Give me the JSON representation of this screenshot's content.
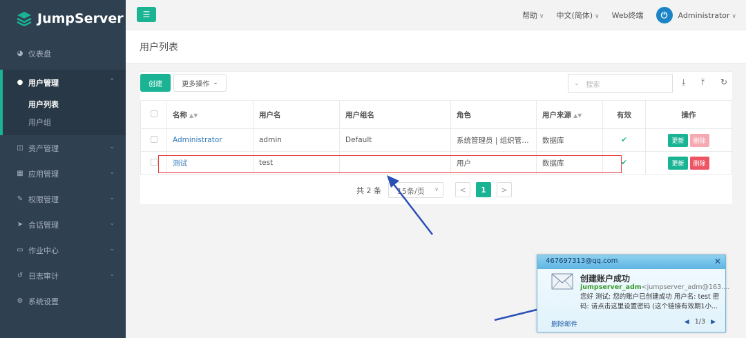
{
  "app": {
    "logo_text": "JumpServer"
  },
  "sidebar": {
    "dashboard": "仪表盘",
    "user_mgmt": "用户管理",
    "user_list": "用户列表",
    "user_group": "用户组",
    "items": [
      "资产管理",
      "应用管理",
      "权限管理",
      "会话管理",
      "作业中心",
      "日志审计",
      "系统设置"
    ]
  },
  "topbar": {
    "help": "帮助",
    "lang": "中文(简体)",
    "webterm": "Web终端",
    "user": "Administrator"
  },
  "page": {
    "title": "用户列表"
  },
  "toolbar": {
    "create": "创建",
    "more": "更多操作",
    "search_placeholder": "搜索"
  },
  "table": {
    "headers": [
      "名称",
      "用户名",
      "用户组名",
      "角色",
      "用户来源",
      "有效",
      "操作"
    ],
    "update_label": "更新",
    "delete_label": "删除",
    "rows": [
      {
        "name": "Administrator",
        "username": "admin",
        "group": "Default",
        "role": "系统管理员 | 组织管…",
        "source": "数据库",
        "valid": "✔"
      },
      {
        "name": "测试",
        "username": "test",
        "group": "",
        "role": "用户",
        "source": "数据库",
        "valid": "✔"
      }
    ]
  },
  "pager": {
    "total": "共 2 条",
    "size": "15条/页",
    "page": "1",
    "prev": "<",
    "next": ">"
  },
  "notification": {
    "account": "467697313@qq.com",
    "subject": "创建账户成功",
    "sender_name": "jumpserver_adm",
    "sender_addr": "<jumpserver_adm@163....",
    "body_line1": "您好 测试: 您的账户已创建成功 用户名: test 密",
    "body_line2": "码: 请点击这里设置密码 (这个链接有效期1小...",
    "delete": "删除邮件",
    "counter": "1/3"
  },
  "colors": {
    "accent": "#1ab394",
    "sidebar": "#2f4050",
    "danger": "#ed5565",
    "highlight": "#e83a3a"
  }
}
